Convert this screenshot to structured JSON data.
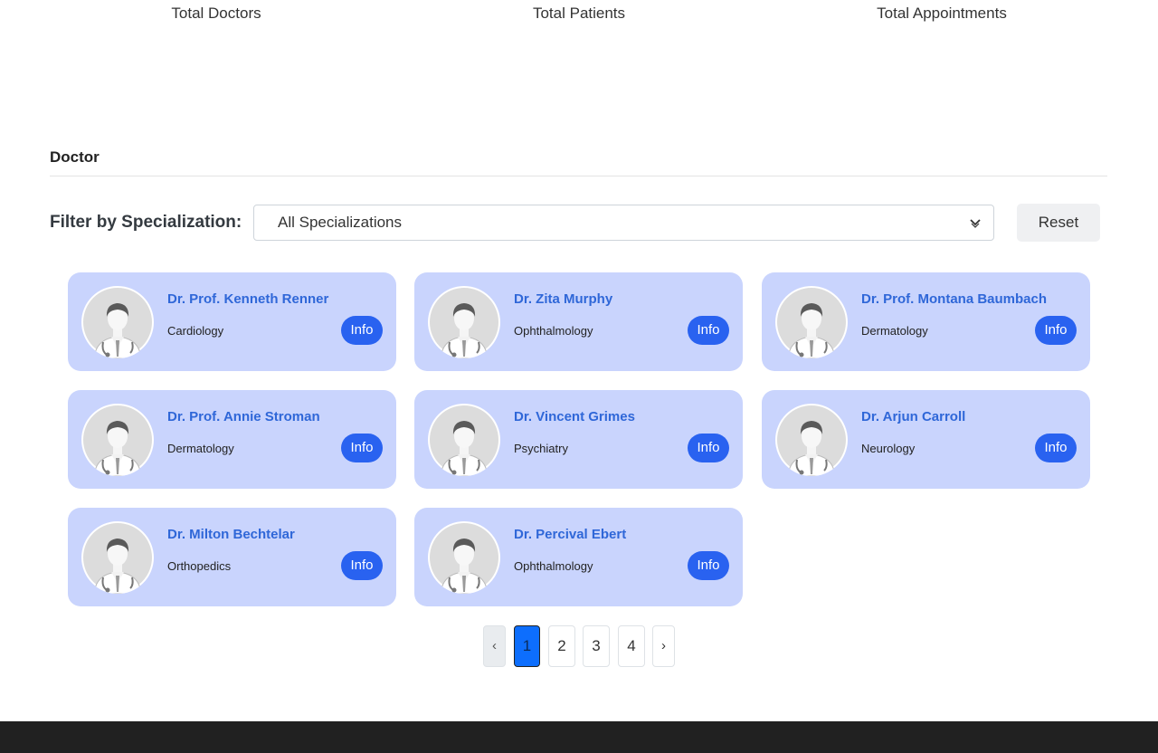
{
  "stats": {
    "doctors_label": "Total Doctors",
    "patients_label": "Total Patients",
    "appointments_label": "Total Appointments"
  },
  "section": {
    "title": "Doctor"
  },
  "filter": {
    "label": "Filter by Specialization:",
    "selected": "All Specializations",
    "reset_label": "Reset"
  },
  "doctors": [
    {
      "name": "Dr. Prof. Kenneth Renner",
      "specialization": "Cardiology",
      "button": "Info"
    },
    {
      "name": "Dr. Zita Murphy",
      "specialization": "Ophthalmology",
      "button": "Info"
    },
    {
      "name": "Dr. Prof. Montana Baumbach",
      "specialization": "Dermatology",
      "button": "Info"
    },
    {
      "name": "Dr. Prof. Annie Stroman",
      "specialization": "Dermatology",
      "button": "Info"
    },
    {
      "name": "Dr. Vincent Grimes",
      "specialization": "Psychiatry",
      "button": "Info"
    },
    {
      "name": "Dr. Arjun Carroll",
      "specialization": "Neurology",
      "button": "Info"
    },
    {
      "name": "Dr. Milton Bechtelar",
      "specialization": "Orthopedics",
      "button": "Info"
    },
    {
      "name": "Dr. Percival Ebert",
      "specialization": "Ophthalmology",
      "button": "Info"
    }
  ],
  "pagination": {
    "prev": "‹",
    "pages": [
      "1",
      "2",
      "3",
      "4"
    ],
    "next": "›",
    "current": "1"
  },
  "colors": {
    "card_bg": "#c9d4fd",
    "name_text": "#2f67d8",
    "info_button": "#2962f0",
    "active_page": "#0d6efd",
    "footer_bg": "#212121"
  },
  "icons": {
    "avatar": "doctor-avatar-icon",
    "select": "chevron-down-icon"
  }
}
